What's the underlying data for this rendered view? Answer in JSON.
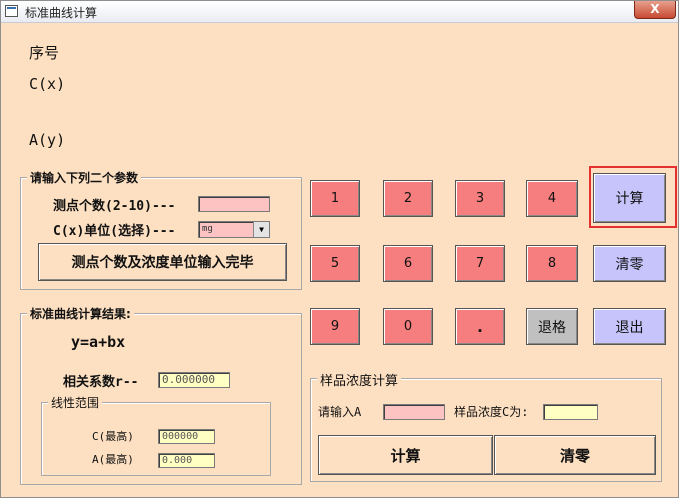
{
  "window": {
    "title": "标准曲线计算",
    "close_label": "X"
  },
  "rows": {
    "serial_label": "序号",
    "cx_label": "C(x)",
    "ay_label": "A(y)"
  },
  "params": {
    "group_title": "请输入下列二个参数",
    "point_count_label": "测点个数(2-10)---",
    "point_count_value": "",
    "unit_label": "C(x)单位(选择)---",
    "unit_selected": "mg",
    "confirm_button": "测点个数及浓度单位输入完毕"
  },
  "result": {
    "group_title": "标准曲线计算结果:",
    "formula": "y=a+bx",
    "r_label": "相关系数r--",
    "r_value": "0.000000",
    "linear_range": {
      "title": "线性范围",
      "c_label": "C(最高)",
      "c_value": "000000",
      "a_label": "A(最高)",
      "a_value": "0.000"
    }
  },
  "keypad": {
    "k1": "1",
    "k2": "2",
    "k3": "3",
    "k4": "4",
    "k5": "5",
    "k6": "6",
    "k7": "7",
    "k8": "8",
    "k9": "9",
    "k0": "0",
    "kdot": ".",
    "backspace": "退格",
    "calc": "计算",
    "clear": "清零",
    "exit": "退出"
  },
  "sample": {
    "group_title": "样品浓度计算",
    "input_label": "请输入A",
    "input_value": "",
    "conc_label": "样品浓度C为:",
    "conc_value": "",
    "calc_button": "计算",
    "clear_button": "清零"
  },
  "colors": {
    "window_bg": "#fde0c2",
    "number_key": "#f67e7e",
    "action_key": "#c6c4fb",
    "backspace_key": "#c0c0c0",
    "input_pink": "#fdc2c2",
    "output_yellow": "#ffffc4",
    "highlight": "#e53030"
  }
}
